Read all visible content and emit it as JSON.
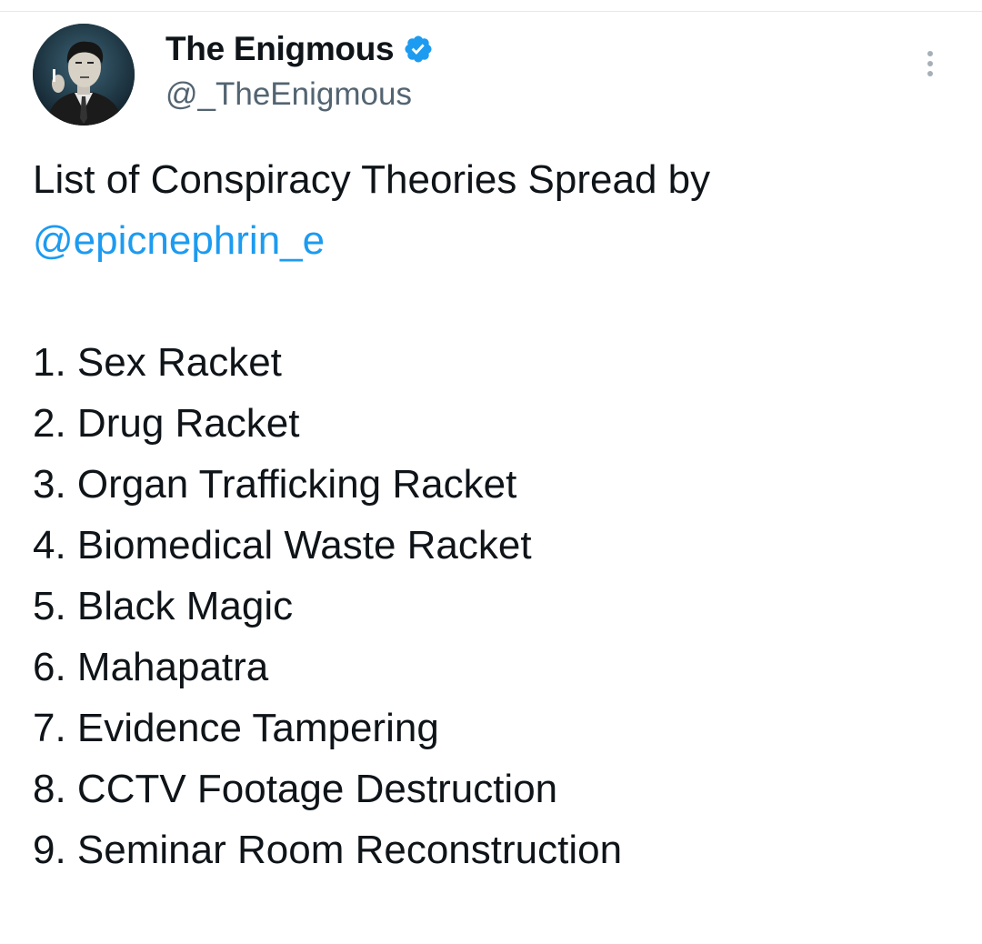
{
  "author": {
    "display_name": "The Enigmous",
    "handle": "@_TheEnigmous",
    "verified": true,
    "verified_color": "#1d9bf0",
    "avatar_icon": "avatar-photo"
  },
  "menu": {
    "more_icon": "more-vertical-icon"
  },
  "tweet": {
    "intro": "List of Conspiracy Theories Spread by",
    "mention": "@epicnephrin_e",
    "mention_color": "#1d9bf0",
    "items": [
      "1. Sex Racket",
      "2. Drug Racket",
      "3. Organ Trafficking Racket",
      "4. Biomedical Waste Racket",
      "5. Black Magic",
      "6. Mahapatra",
      "7. Evidence Tampering",
      "8. CCTV Footage Destruction",
      "9. Seminar Room Reconstruction"
    ]
  }
}
